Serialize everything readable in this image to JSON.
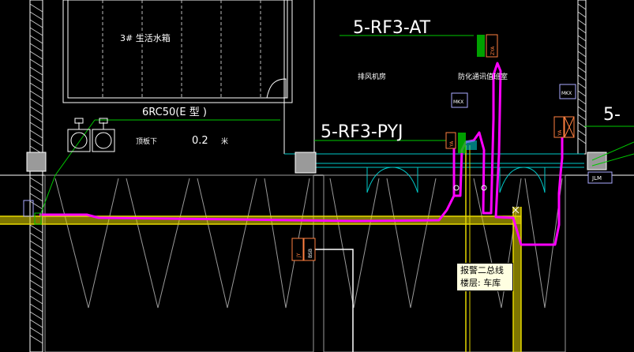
{
  "labels": {
    "tag_at": "5-RF3-AT",
    "tag_pyj": "5-RF3-PYJ",
    "tag_right": "5-",
    "tank": "3# 生活水箱",
    "pipe_spec": "6RC50(E  型   )",
    "floor_under": "顶板下",
    "height_value": "0.2",
    "height_unit": "米",
    "exhaust_room": "排风机房",
    "smoke_room": "防化通讯值班室"
  },
  "device_tags": {
    "mkx_a": "MKX",
    "mkx_b": "MKX",
    "jlm": "JLM",
    "bsb": "BSB",
    "jy": "JY",
    "ya_a": "ZYA",
    "ya_b": "YA",
    "ya_c": "YA"
  },
  "tooltip": {
    "line1": "报警二总线",
    "line2": "楼层: 车库"
  },
  "colors": {
    "background": "#000000",
    "highlight": "#ff00ff",
    "wall": "#e6d700",
    "cyan": "#00c8c8",
    "green": "#00c800",
    "grey": "#9a9a9a"
  }
}
